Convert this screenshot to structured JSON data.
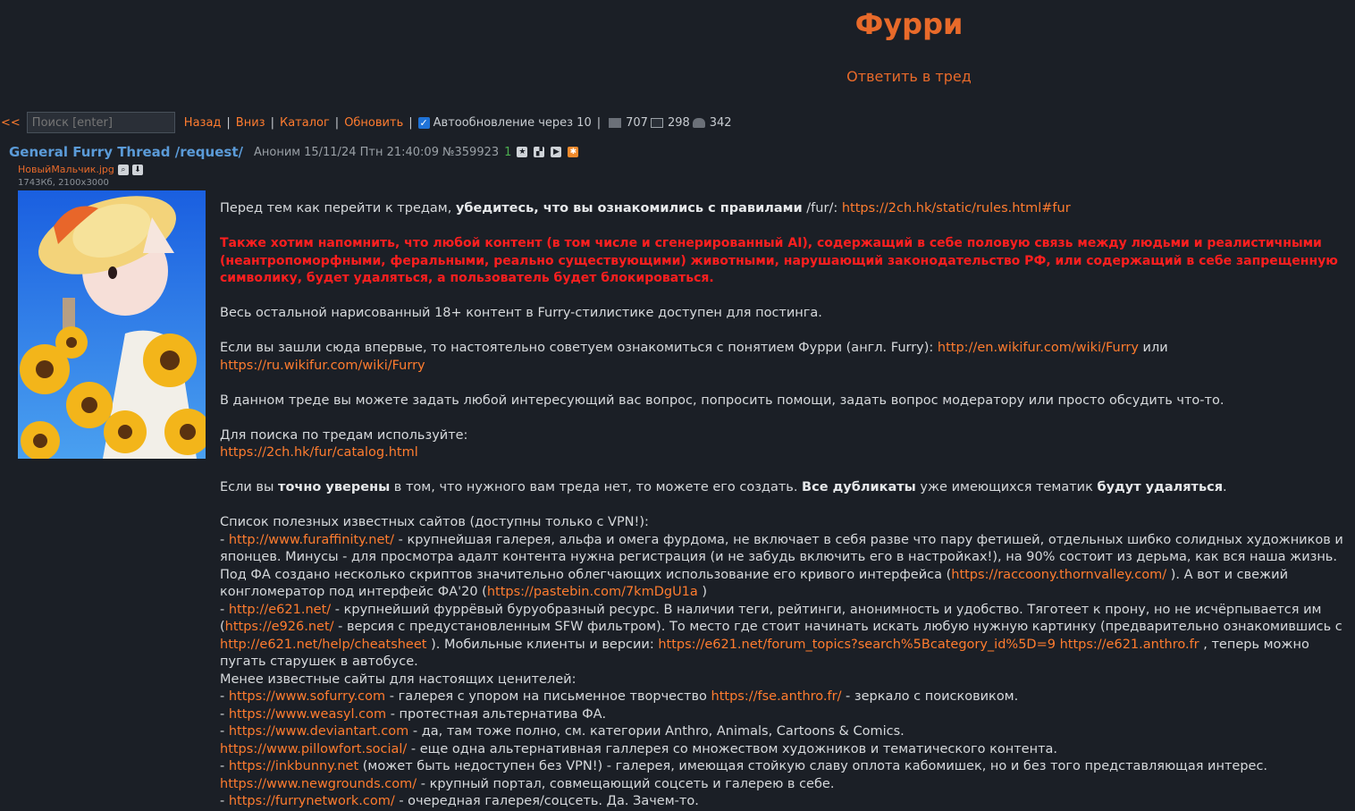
{
  "board": {
    "title": "Фурри",
    "reply_label": "Ответить в тред"
  },
  "navbar": {
    "back_arrow": "<<",
    "search_placeholder": "Поиск [enter]",
    "links": [
      "Назад",
      "Вниз",
      "Каталог",
      "Обновить"
    ],
    "autoupdate_label": "Автообновление через 10",
    "posts_count": "707",
    "images_count": "298",
    "posters_count": "342",
    "icons": [
      "comment-icon",
      "image-icon",
      "users-icon"
    ]
  },
  "op": {
    "subject": "General Furry Thread /request/",
    "poster": "Аноним",
    "date": "15/11/24 Птн 21:40:09",
    "number": "№359923",
    "replies": "1",
    "file_name": "НовыйМальчик.jpg",
    "file_meta": "1743Кб, 2100x3000"
  },
  "body": {
    "p1_a": "Перед тем как перейти к тредам, ",
    "p1_b": "убедитесь, что вы ознакомились с правилами",
    "p1_c": " /fur/: ",
    "p1_link": "https://2ch.hk/static/rules.html#fur",
    "warning": "Также хотим напомнить, что любой контент (в том числе и сгенерированный AI), содержащий в себе половую связь между людьми и реалистичными (неантропоморфными, феральными, реально существующими) животными, нарушающий законодательство РФ, или содержащий в себе запрещенную символику, будет удаляться, а пользователь будет блокироваться.",
    "p3": "Весь остальной нарисованный 18+ контент в Furry-стилистике доступен для постинга.",
    "p4_a": "Если вы зашли сюда впервые, то настоятельно советуем ознакомиться с понятием Фурри (англ. Furry): ",
    "p4_link1": "http://en.wikifur.com/wiki/Furry",
    "p4_b": " или ",
    "p4_link2": "https://ru.wikifur.com/wiki/Furry",
    "p5": "В данном треде вы можете задать любой интересующий вас вопрос, попросить помощи, задать вопрос модератору или просто обсудить что-то.",
    "p6": "Для поиска по тредам используйте:",
    "p6_link": "https://2ch.hk/fur/catalog.html",
    "p7_a": "Если вы ",
    "p7_b": "точно уверены",
    "p7_c": " в том, что нужного вам треда нет, то можете его создать. ",
    "p7_d": "Все дубликаты",
    "p7_e": " уже имеющихся тематик ",
    "p7_f": "будут удаляться",
    "p7_g": ".",
    "sites_header": "Список полезных известных сайтов (доступны только с VPN!):",
    "fa_link": "http://www.furaffinity.net/",
    "fa_text": " - крупнейшая галерея, альфа и омега фурдома, не включает в себя разве что пару фетишей, отдельных шибко солидных художников и японцев. Минусы - для просмотра адалт контента нужна регистрация (и не забудь включить его в настройках!), на 90% состоит из дерьма, как вся наша жизнь. Под ФА создано несколько скриптов значительно облегчающих использование его кривого интерфейса (",
    "fa_link2": "https://raccoony.thornvalley.com/",
    "fa_text2": " ). А вот и свежий конгломератор под интерфейс ФА'20 (",
    "fa_link3": "https://pastebin.com/7kmDgU1a",
    "fa_text3": " )",
    "e621_link": "http://e621.net/",
    "e621_text": " - крупнейший фуррёвый буруобразный ресурс. В наличии теги, рейтинги, анонимность и удобство. Тяготеет к прону, но не исчёрпывается им (",
    "e926_link": "https://e926.net/",
    "e926_text": " - версия с предустановленным SFW фильтром). То место где стоит начинать искать любую нужную картинку (предварительно ознакомившись с ",
    "cheat_link": "http://e621.net/help/cheatsheet",
    "cheat_text": " ). Мобильные клиенты и версии: ",
    "forum_link": "https://e621.net/forum_topics?search%5Bcategory_id%5D=9",
    "anthro_link": "https://e621.anthro.fr",
    "anthro_text": " , теперь можно пугать старушек в автобусе.",
    "lesser_header": "Менее известные сайты для настоящих ценителей:",
    "sofurry_link": "https://www.sofurry.com",
    "sofurry_text": " - галерея с упором на письменное творчество ",
    "fse_link": "https://fse.anthro.fr/",
    "fse_text": " - зеркало с поисковиком.",
    "weasyl_link": "https://www.weasyl.com",
    "weasyl_text": " - протестная альтернатива ФА.",
    "da_link": "https://www.deviantart.com",
    "da_text": " - да, там тоже полно, см. категории Anthro, Animals, Cartoons & Comics.",
    "pillow_link": "https://www.pillowfort.social/",
    "pillow_text": " - еще одна альтернативная галлерея со множеством художников и тематического контента.",
    "ink_link": "https://inkbunny.net",
    "ink_text": " (может быть недоступен без VPN!) - галерея, имеющая стойкую славу оплота кабомишек, но и без того представляющая интерес.",
    "ng_link": "https://www.newgrounds.com/",
    "ng_text": " - крупный портал, совмещающий соцсеть и галерею в себе.",
    "fn_link": "https://furrynetwork.com/",
    "fn_text": " - очередная галерея/соцсеть. Да. Зачем-то.",
    "dash": "- "
  }
}
